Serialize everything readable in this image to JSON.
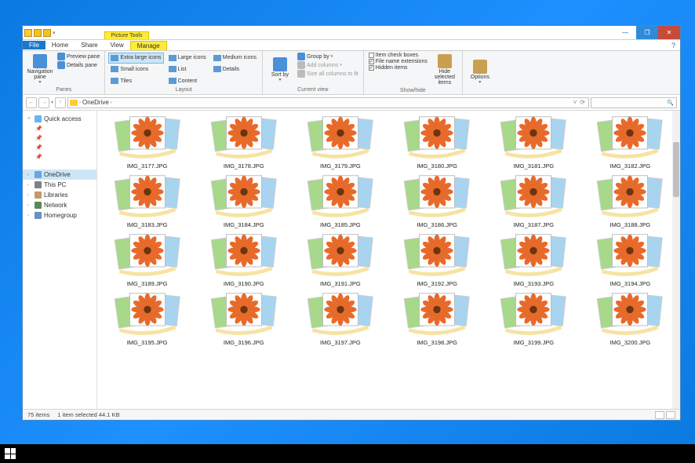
{
  "titlebar": {
    "context_tab": "Picture Tools",
    "help_tip": "?"
  },
  "win_controls": {
    "min": "—",
    "restore": "❐",
    "close": "✕"
  },
  "menu": {
    "file": "File",
    "home": "Home",
    "share": "Share",
    "view": "View",
    "manage": "Manage"
  },
  "ribbon": {
    "panes": {
      "nav": "Navigation pane",
      "preview": "Preview pane",
      "details": "Details pane",
      "label": "Panes"
    },
    "layout": {
      "xl": "Extra large icons",
      "lg": "Large icons",
      "md": "Medium icons",
      "sm": "Small icons",
      "list": "List",
      "details": "Details",
      "tiles": "Tiles",
      "content": "Content",
      "label": "Layout"
    },
    "cv": {
      "sort": "Sort by",
      "group": "Group by",
      "addcols": "Add columns",
      "size": "Size all columns to fit",
      "label": "Current view"
    },
    "sh": {
      "chk": "Item check boxes",
      "ext": "File name extensions",
      "hid": "Hidden items",
      "hidesel": "Hide selected items",
      "label": "Show/hide"
    },
    "opt": {
      "options": "Options"
    }
  },
  "address": {
    "back": "←",
    "fwd": "→",
    "up": "↑",
    "crumb1": "OneDrive",
    "refresh": "⟳",
    "dd": "˅"
  },
  "nav": {
    "quick": "Quick access",
    "onedrive": "OneDrive",
    "thispc": "This PC",
    "libraries": "Libraries",
    "network": "Network",
    "homegroup": "Homegroup"
  },
  "files": [
    "IMG_3177.JPG",
    "IMG_3178.JPG",
    "IMG_3179.JPG",
    "IMG_3180.JPG",
    "IMG_3181.JPG",
    "IMG_3182.JPG",
    "IMG_3183.JPG",
    "IMG_3184.JPG",
    "IMG_3185.JPG",
    "IMG_3186.JPG",
    "IMG_3187.JPG",
    "IMG_3188.JPG",
    "IMG_3189.JPG",
    "IMG_3190.JPG",
    "IMG_3191.JPG",
    "IMG_3192.JPG",
    "IMG_3193.JPG",
    "IMG_3194.JPG",
    "IMG_3195.JPG",
    "IMG_3196.JPG",
    "IMG_3197.JPG",
    "IMG_3198.JPG",
    "IMG_3199.JPG",
    "IMG_3200.JPG"
  ],
  "status": {
    "count": "75 items",
    "sel": "1 item selected  44.1 KB"
  }
}
